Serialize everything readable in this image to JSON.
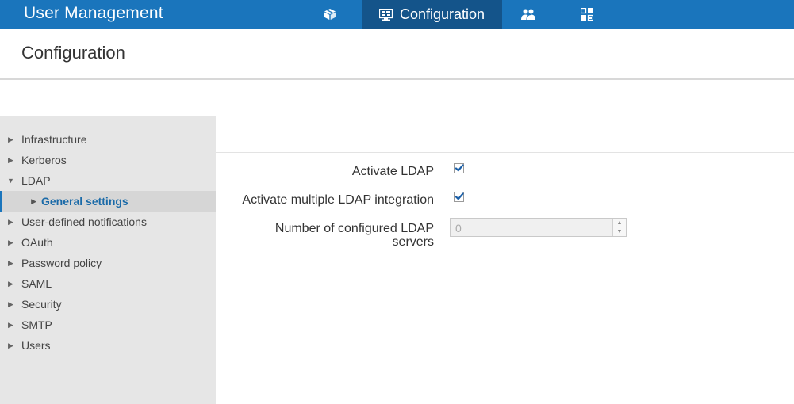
{
  "app": {
    "title": "User Management"
  },
  "nav": [
    {
      "icon": "package-icon",
      "label": ""
    },
    {
      "icon": "configuration-icon",
      "label": "Configuration",
      "active": true
    },
    {
      "icon": "users-icon",
      "label": ""
    },
    {
      "icon": "dashboard-icon",
      "label": ""
    }
  ],
  "page": {
    "title": "Configuration"
  },
  "sidebar": {
    "items": [
      {
        "label": "Infrastructure",
        "expanded": false
      },
      {
        "label": "Kerberos",
        "expanded": false
      },
      {
        "label": "LDAP",
        "expanded": true
      },
      {
        "label": "General settings",
        "child": true,
        "selected": true
      },
      {
        "label": "User-defined notifications",
        "expanded": false
      },
      {
        "label": "OAuth",
        "expanded": false
      },
      {
        "label": "Password policy",
        "expanded": false
      },
      {
        "label": "SAML",
        "expanded": false
      },
      {
        "label": "Security",
        "expanded": false
      },
      {
        "label": "SMTP",
        "expanded": false
      },
      {
        "label": "Users",
        "expanded": false
      }
    ]
  },
  "form": {
    "activate_ldap": {
      "label": "Activate LDAP",
      "checked": true
    },
    "activate_multiple": {
      "label": "Activate multiple LDAP integration",
      "checked": true
    },
    "num_servers": {
      "label_line1": "Number of configured LDAP",
      "label_line2": "servers",
      "value": "0"
    }
  },
  "colors": {
    "accent": "#1a75bc",
    "active_nav": "#14548a",
    "sidebar_bg": "#e6e6e6"
  }
}
